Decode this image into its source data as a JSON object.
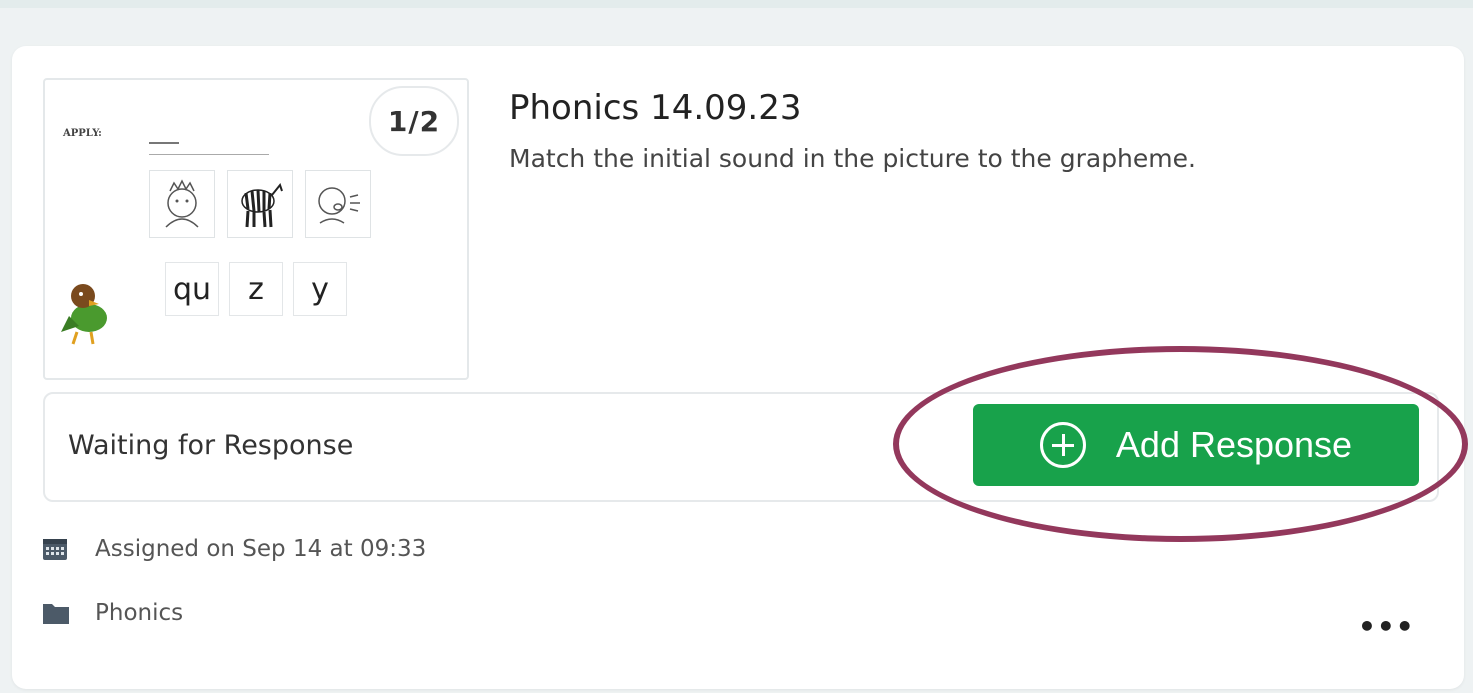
{
  "assignment": {
    "thumbnail": {
      "apply_label": "APPLY:",
      "page_indicator": "1/2",
      "graphemes": [
        "qu",
        "z",
        "y"
      ]
    },
    "title": "Phonics 14.09.23",
    "description": "Match the initial sound in the picture to the grapheme.",
    "status": "Waiting for Response",
    "add_response_label": "Add Response",
    "assigned_text": "Assigned on Sep 14 at 09:33",
    "folder": "Phonics",
    "more_label": "•••"
  },
  "colors": {
    "add_button": "#18a24b",
    "highlight_ring": "#93385c"
  },
  "icons": {
    "add": "plus-circle-icon",
    "calendar": "calendar-icon",
    "folder": "folder-icon",
    "more": "more-horizontal-icon"
  }
}
